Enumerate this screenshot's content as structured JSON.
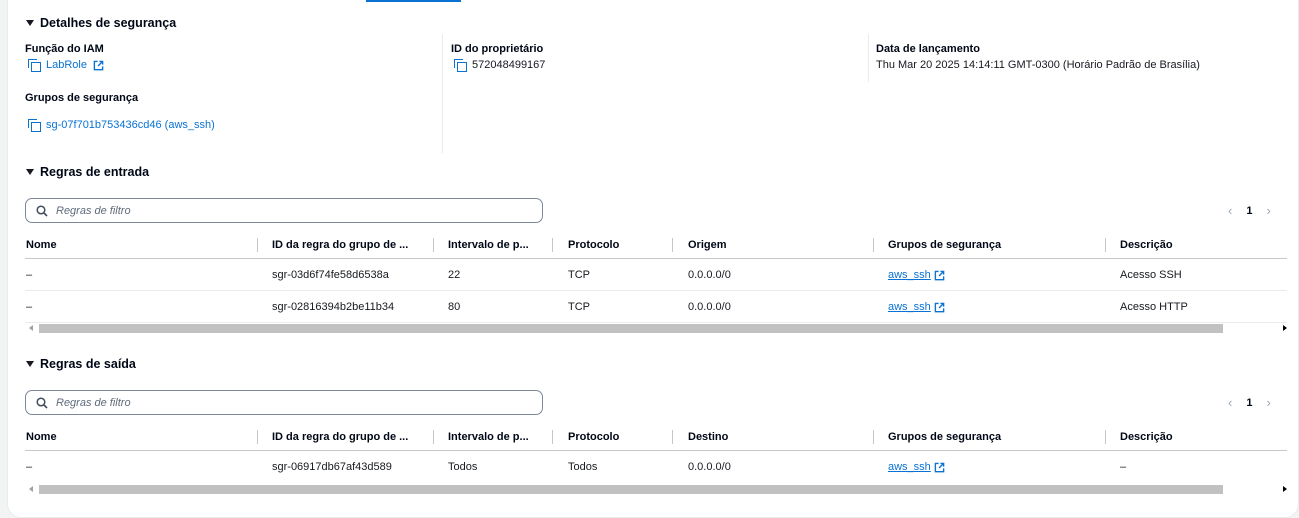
{
  "security_details": {
    "title": "Detalhes de segurança",
    "iam_role_label": "Função do IAM",
    "iam_role_value": "LabRole",
    "owner_id_label": "ID do proprietário",
    "owner_id_value": "572048499167",
    "launch_date_label": "Data de lançamento",
    "launch_date_value": "Thu Mar 20 2025 14:14:11 GMT-0300 (Horário Padrão de Brasília)",
    "security_groups_label": "Grupos de segurança",
    "security_groups_value": "sg-07f701b753436cd46 (aws_ssh)"
  },
  "inbound": {
    "title": "Regras de entrada",
    "filter_placeholder": "Regras de filtro",
    "page": "1",
    "headers": [
      "Nome",
      "ID da regra do grupo de ...",
      "Intervalo de p...",
      "Protocolo",
      "Origem",
      "Grupos de segurança",
      "Descrição"
    ],
    "rows": [
      {
        "name": "–",
        "rule_id": "sgr-03d6f74fe58d6538a",
        "port_range": "22",
        "protocol": "TCP",
        "source": "0.0.0.0/0",
        "security_group": "aws_ssh",
        "description": "Acesso SSH"
      },
      {
        "name": "–",
        "rule_id": "sgr-02816394b2be11b34",
        "port_range": "80",
        "protocol": "TCP",
        "source": "0.0.0.0/0",
        "security_group": "aws_ssh",
        "description": "Acesso HTTP"
      }
    ]
  },
  "outbound": {
    "title": "Regras de saída",
    "filter_placeholder": "Regras de filtro",
    "page": "1",
    "headers": [
      "Nome",
      "ID da regra do grupo de ...",
      "Intervalo de p...",
      "Protocolo",
      "Destino",
      "Grupos de segurança",
      "Descrição"
    ],
    "rows": [
      {
        "name": "–",
        "rule_id": "sgr-06917db67af43d589",
        "port_range": "Todos",
        "protocol": "Todos",
        "destination": "0.0.0.0/0",
        "security_group": "aws_ssh",
        "description": "–"
      }
    ]
  },
  "colors": {
    "link": "#0972d3",
    "border": "#e9ebed",
    "text": "#16191f"
  },
  "icons": {
    "copy": "copy-icon",
    "external": "external-link-icon",
    "search": "search-icon",
    "caret": "caret-down-icon"
  }
}
